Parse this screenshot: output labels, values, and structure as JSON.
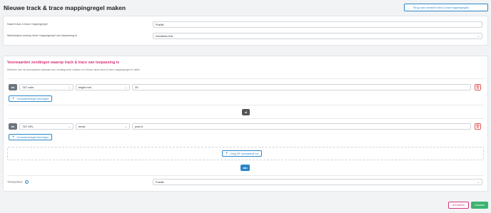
{
  "page": {
    "title": "Nieuwe track & trace mappingregel maken",
    "back_label": "Terug naar overzicht track & trace mappingregels"
  },
  "general": {
    "name_label": "Naam track & trace mappingregel",
    "name_value": "PostNL",
    "marketplace_label": "Marketplace waarop deze mappingregel van toepassing is",
    "marketplace_value": "Decathlon test"
  },
  "conditions": {
    "title": "Voorwaarden zendingen waarop track & trace van toepassing is",
    "description": "Definieer hier de voorwaarden waaraan een zending moet voldoen om binnen deze track & trace mappingregel te vallen.",
    "and_label": "als",
    "add_condition_label": "Voorwaarderegel toevoegen",
    "or_label": "of",
    "groups": [
      {
        "field": "T&T code",
        "operator": "begint met",
        "value": "3S"
      },
      {
        "field": "T&T URL",
        "operator": "bevat",
        "value": "post.nl"
      }
    ],
    "add_or_label": "Voeg OF voorwaarde toe",
    "then_label": "dan"
  },
  "carrier": {
    "label": "Transporteur",
    "value": "PostNL"
  },
  "footer": {
    "cancel_label": "Annuleren",
    "save_label": "Opslaan"
  }
}
